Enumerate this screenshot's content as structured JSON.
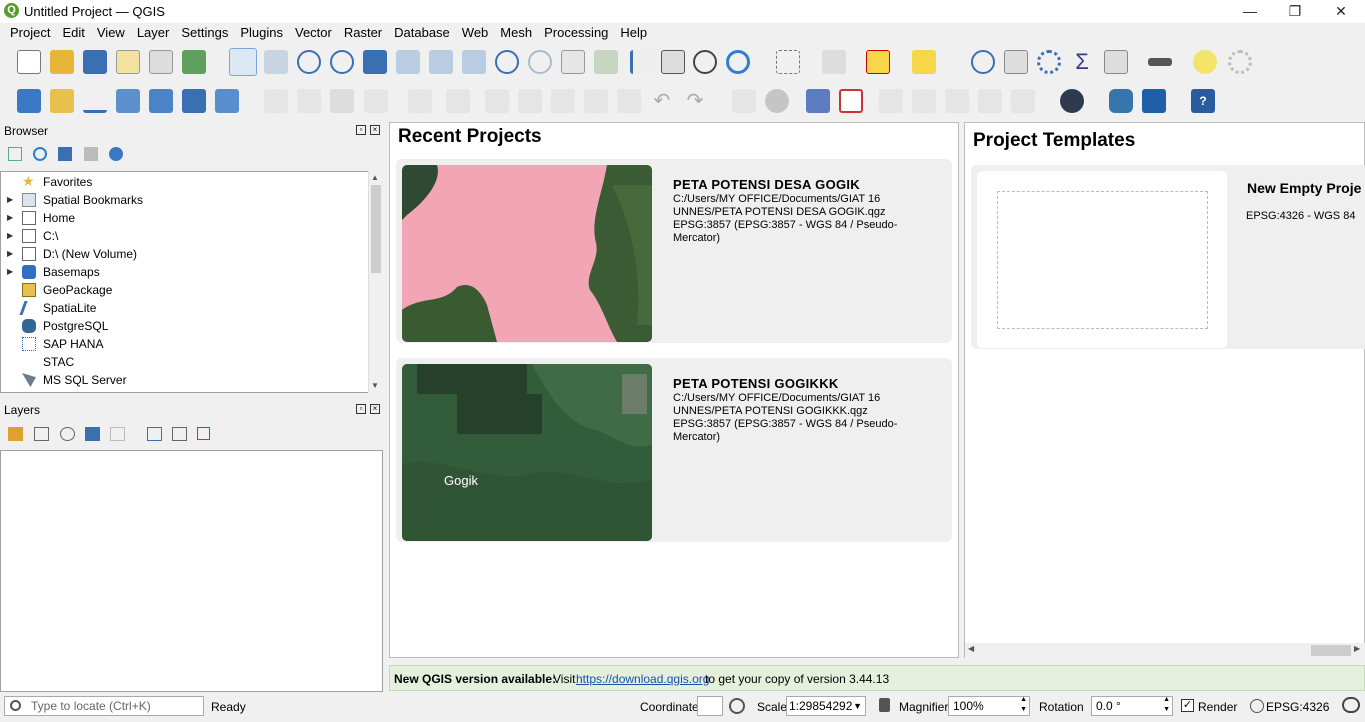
{
  "window": {
    "title": "Untitled Project — QGIS",
    "minimize": "—",
    "maximize": "❐",
    "close": "✕"
  },
  "menu": [
    "Project",
    "Edit",
    "View",
    "Layer",
    "Settings",
    "Plugins",
    "Vector",
    "Raster",
    "Database",
    "Web",
    "Mesh",
    "Processing",
    "Help"
  ],
  "browser": {
    "title": "Browser",
    "items": [
      {
        "label": "Favorites",
        "icon": "star-icon",
        "expandable": false
      },
      {
        "label": "Spatial Bookmarks",
        "icon": "bookmark-icon",
        "expandable": true
      },
      {
        "label": "Home",
        "icon": "home-icon",
        "expandable": true
      },
      {
        "label": "C:\\",
        "icon": "folder-icon",
        "expandable": true
      },
      {
        "label": "D:\\ (New Volume)",
        "icon": "folder-icon",
        "expandable": true
      },
      {
        "label": "Basemaps",
        "icon": "globe-icon",
        "expandable": true
      },
      {
        "label": "GeoPackage",
        "icon": "geopackage-icon",
        "expandable": false
      },
      {
        "label": "SpatiaLite",
        "icon": "spatialite-icon",
        "expandable": false
      },
      {
        "label": "PostgreSQL",
        "icon": "postgresql-icon",
        "expandable": false
      },
      {
        "label": "SAP HANA",
        "icon": "hana-icon",
        "expandable": false
      },
      {
        "label": "STAC",
        "icon": "stac-icon",
        "expandable": false
      },
      {
        "label": "MS SQL Server",
        "icon": "mssql-icon",
        "expandable": false
      }
    ]
  },
  "layers": {
    "title": "Layers"
  },
  "recent": {
    "heading": "Recent Projects",
    "projects": [
      {
        "name": "PETA POTENSI DESA GOGIK",
        "path": "C:/Users/MY OFFICE/Documents/GIAT 16 UNNES/PETA POTENSI DESA GOGIK.qgz",
        "crs": "EPSG:3857 (EPSG:3857 - WGS 84 / Pseudo-Mercator)"
      },
      {
        "name": "PETA POTENSI GOGIKKK",
        "path": "C:/Users/MY OFFICE/Documents/GIAT 16 UNNES/PETA POTENSI GOGIKKK.qgz",
        "crs": "EPSG:3857 (EPSG:3857 - WGS 84 / Pseudo-Mercator)",
        "map_label": "Gogik"
      }
    ]
  },
  "templates": {
    "heading": "Project Templates",
    "name": "New Empty Proje",
    "crs": "EPSG:4326 - WGS 84"
  },
  "notice": {
    "bold": "New QGIS version available:",
    "pre": "Visit",
    "link": "https://download.qgis.org",
    "post": "to get your copy of version 3.44.13"
  },
  "status": {
    "locator_placeholder": "Type to locate (Ctrl+K)",
    "ready": "Ready",
    "coordinate_label": "Coordinate",
    "coordinate_value": "",
    "scale_label": "Scale",
    "scale_value": "1:29854292",
    "magnifier_label": "Magnifier",
    "magnifier_value": "100%",
    "rotation_label": "Rotation",
    "rotation_value": "0.0 °",
    "render_label": "Render",
    "render_checked": true,
    "crs": "EPSG:4326"
  },
  "colors": {
    "qgis_green": "#5b9b2d",
    "polygon_pink": "#f2a5b4",
    "notice_bg": "#e4f0db",
    "link": "#1a4fb0"
  }
}
